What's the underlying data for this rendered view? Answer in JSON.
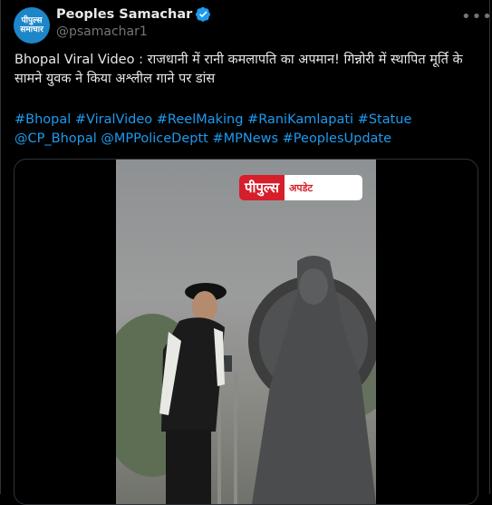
{
  "author": {
    "name": "Peoples Samachar",
    "handle": "@psamachar1",
    "avatar_line1": "पीपुल्स",
    "avatar_line2": "समाचार"
  },
  "tweet": {
    "text": "Bhopal Viral Video : राजधानी में रानी कमलापति का अपमान! गिन्नोरी में स्थापित मूर्ति के सामने युवक ने किया अश्लील गाने पर डांस",
    "hashtags": [
      "#Bhopal",
      "#ViralVideo",
      "#ReelMaking",
      "#RaniKamlapati",
      "#Statue"
    ],
    "mentions": [
      "@CP_Bhopal",
      "@MPPoliceDeptt"
    ],
    "hashtags2": [
      "#MPNews",
      "#PeoplesUpdate"
    ]
  },
  "media": {
    "badge_main": "पीपुल्स",
    "badge_sub": "अपडेट"
  },
  "colors": {
    "link": "#1d9bf0",
    "verified": "#1d9bf0",
    "background": "#000000"
  },
  "icons": {
    "verified": "verified-badge-icon",
    "more": "more-options-icon"
  }
}
